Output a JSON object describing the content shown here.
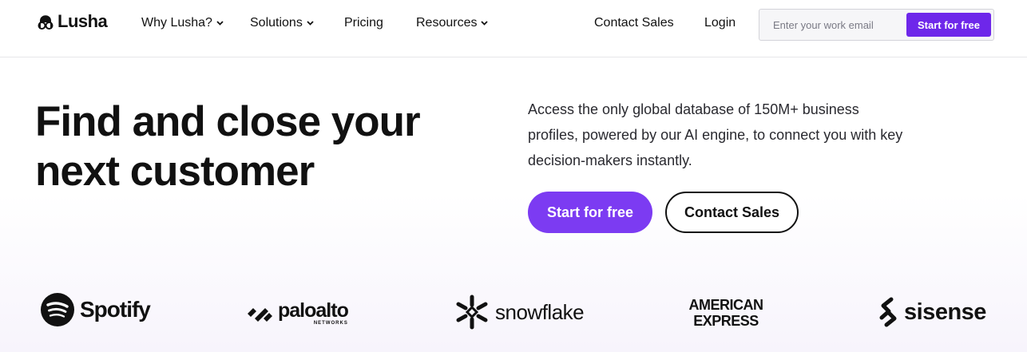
{
  "nav": {
    "logo_text": "Lusha",
    "links": {
      "why": "Why Lusha?",
      "solutions": "Solutions",
      "pricing": "Pricing",
      "resources": "Resources",
      "contact_sales": "Contact Sales",
      "login": "Login"
    },
    "signup": {
      "placeholder": "Enter your work email",
      "button": "Start for free"
    }
  },
  "hero": {
    "title_line1": "Find and close your",
    "title_line2": "next customer",
    "description": "Access the only global database of 150M+ business profiles, powered by our AI engine, to connect you with key decision-makers instantly.",
    "primary_cta": "Start for free",
    "secondary_cta": "Contact Sales"
  },
  "logos": {
    "spotify": "Spotify",
    "paloalto": "paloalto",
    "paloalto_sub": "NETWORKS",
    "snowflake": "snowflake",
    "amex_line1": "AMERICAN",
    "amex_line2": "EXPRESS",
    "sisense": "sisense"
  },
  "colors": {
    "accent": "#7c3bf2",
    "accent_dark": "#6e27ea",
    "text": "#111111"
  }
}
